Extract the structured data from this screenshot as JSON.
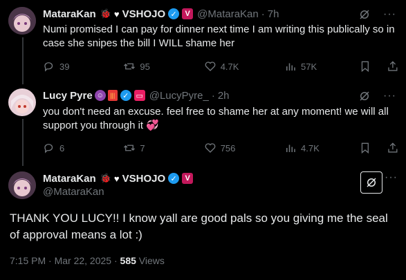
{
  "tweets": [
    {
      "name": "MataraKan",
      "org": "VSHOJO",
      "handle": "@MataraKan",
      "time": "7h",
      "text": "Numi promised I can pay for dinner next time I am writing this publically so in case she snipes the bill I WILL shame her",
      "replies": "39",
      "reposts": "95",
      "likes": "4.7K",
      "views": "57K"
    },
    {
      "name": "Lucy Pyre",
      "handle": "@LucyPyre_",
      "time": "2h",
      "text": "you don't need an excuse. feel free to shame her at any moment! we will all support you through it",
      "replies": "6",
      "reposts": "7",
      "likes": "756",
      "views": "4.7K"
    }
  ],
  "main": {
    "name": "MataraKan",
    "org": "VSHOJO",
    "handle": "@MataraKan",
    "text": "THANK YOU LUCY!! I know yall are good pals so you giving me the seal of approval means a lot :)",
    "datetime": "7:15 PM · Mar 22, 2025 · ",
    "views_count": "585",
    "views_label": " Views"
  },
  "colors": {
    "background": "#000000",
    "text": "#e7e9ea",
    "muted": "#71767b",
    "verified": "#1d9bf0",
    "badge_pink": "#c2185b"
  },
  "icons": [
    "grok-icon",
    "reply-icon",
    "repost-icon",
    "like-icon",
    "views-icon",
    "bookmark-icon",
    "share-icon"
  ]
}
